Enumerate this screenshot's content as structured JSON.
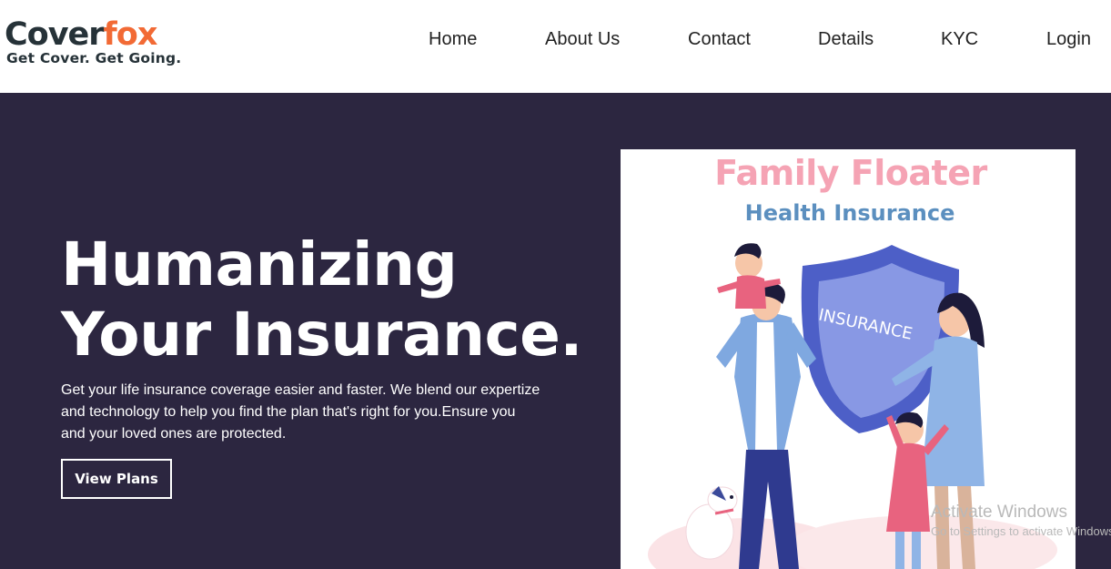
{
  "brand": {
    "name_part1": "Cover",
    "name_part2": "fox",
    "tagline": "Get Cover. Get Going.",
    "colors": {
      "dark": "#263238",
      "accent": "#f26a35"
    }
  },
  "nav": {
    "items": [
      {
        "label": "Home"
      },
      {
        "label": "About Us"
      },
      {
        "label": "Contact"
      },
      {
        "label": "Details"
      },
      {
        "label": "KYC"
      },
      {
        "label": "Login"
      }
    ]
  },
  "hero": {
    "title_line1": "Humanizing",
    "title_line2": "Your Insurance.",
    "description": "Get your life insurance coverage easier and faster. We blend our expertize and technology to help you find the plan that's right for you.Ensure you and your loved ones are protected.",
    "cta_label": "View Plans",
    "background": "#2c2640"
  },
  "promo_image": {
    "title": "Family Floater",
    "subtitle": "Health Insurance",
    "shield_text": "INSURANCE",
    "title_color": "#f5a3b4",
    "subtitle_color": "#5b8fbf",
    "shield_color": "#4d5fc7"
  },
  "watermark": {
    "title": "Activate Windows",
    "subtitle": "Go to Settings to activate Windows."
  }
}
